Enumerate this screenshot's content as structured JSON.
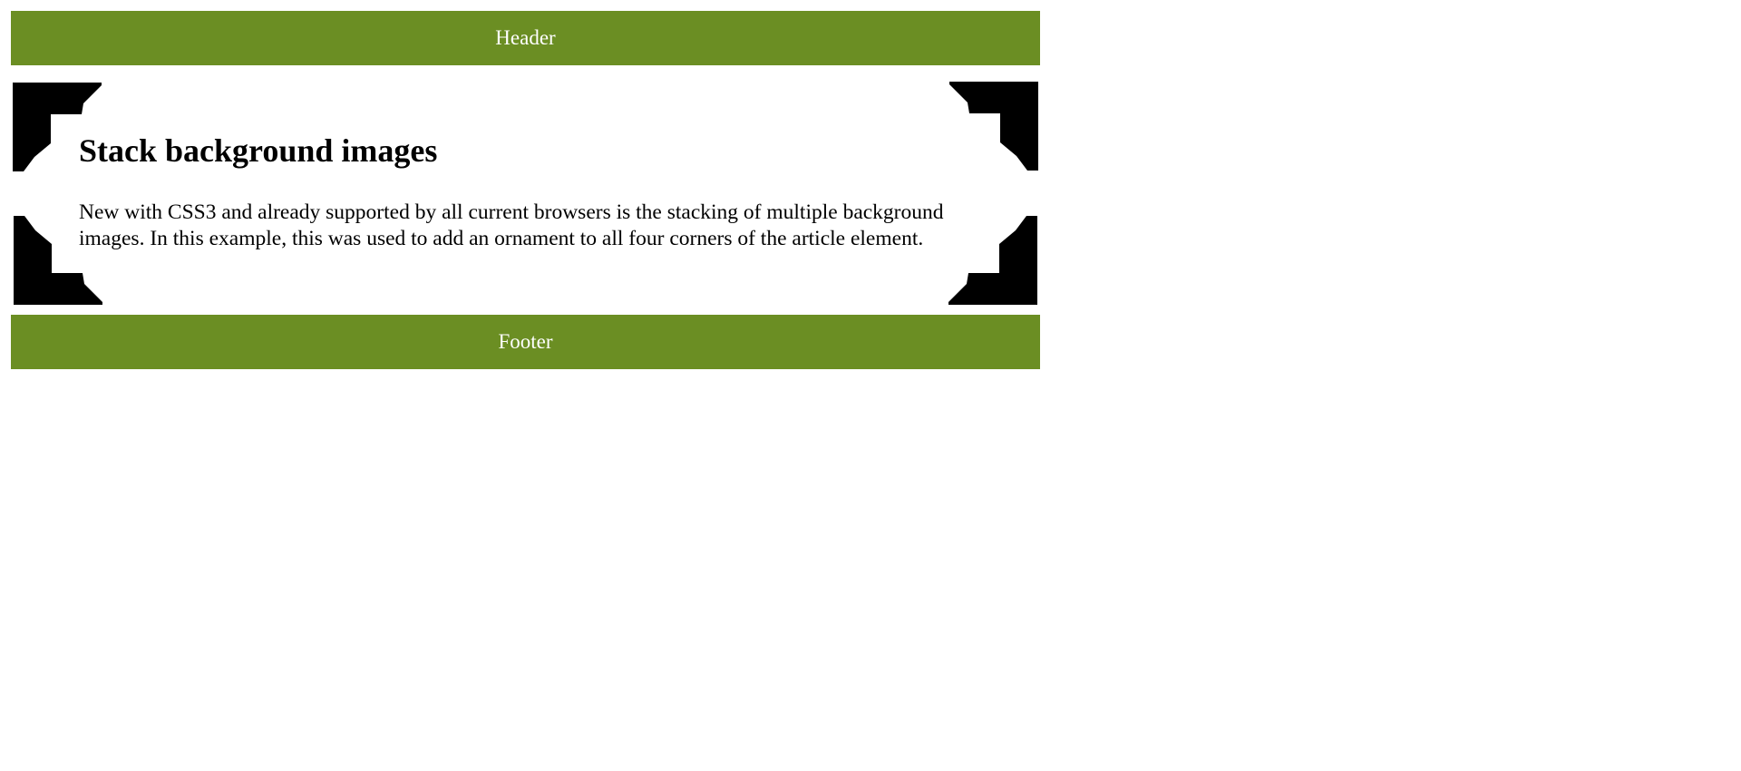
{
  "header": {
    "label": "Header"
  },
  "article": {
    "title": "Stack background images",
    "text": "New with CSS3 and already supported by all current browsers is the stacking of multiple background images. In this example, this was used to add an ornament to all four corners of the article element."
  },
  "footer": {
    "label": "Footer"
  },
  "colors": {
    "bar_background": "#6b8e23",
    "bar_text": "#ffffff",
    "ornament": "#000000",
    "page_background": "#ffffff"
  },
  "icons": [
    "corner-ornament-icon"
  ]
}
